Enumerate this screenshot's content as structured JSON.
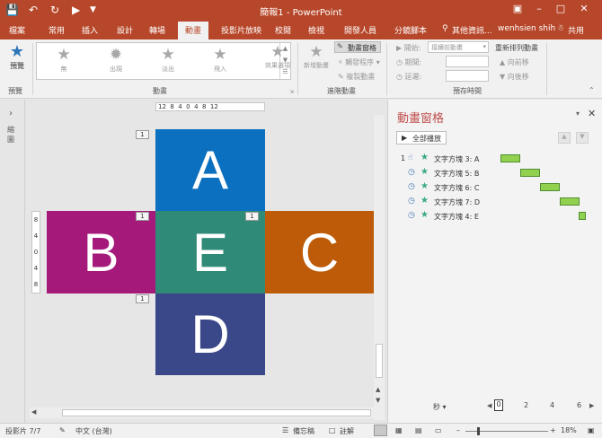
{
  "titlebar": {
    "title": "簡報1 - PowerPoint",
    "save_icon": "save-icon",
    "undo_icon": "undo-icon",
    "redo_icon": "redo-icon"
  },
  "tabs": [
    "檔案",
    "常用",
    "插入",
    "設計",
    "轉場",
    "動畫",
    "投影片放映",
    "校閱",
    "檢視",
    "開發人員",
    "分鏡腳本"
  ],
  "active_tab": "動畫",
  "tellme": "其他資訊...",
  "user": "wenhsien shih",
  "share": "共用",
  "ribbon": {
    "preview": {
      "label": "預覽",
      "group": "預覽"
    },
    "animation_gallery": [
      "無",
      "出現",
      "淡出",
      "飛入"
    ],
    "effect_options": "效果選項",
    "animation_group": "動畫",
    "add_animation": "新增動畫",
    "animation_pane_btn": "動畫窗格",
    "trigger": "觸發程序",
    "copy_animation": "複製動畫",
    "advanced_group": "進階動畫",
    "start_label": "開始:",
    "start_value": "接續前動畫",
    "duration_label": "期間:",
    "delay_label": "延遲:",
    "timing_group": "預存時間",
    "reorder_label": "重新排列動畫",
    "move_earlier": "向前移",
    "move_later": "向後移"
  },
  "left_strip": {
    "label": "縮圖"
  },
  "ruler_h": "12  8  4  0  4  8  12",
  "ruler_v": [
    "8",
    "4",
    "0",
    "4",
    "8"
  ],
  "slide": {
    "tiles": [
      {
        "letter": "A",
        "color": "#0b70bf"
      },
      {
        "letter": "B",
        "color": "#a4197a"
      },
      {
        "letter": "E",
        "color": "#308a78"
      },
      {
        "letter": "C",
        "color": "#bd5b08"
      },
      {
        "letter": "D",
        "color": "#3a4788"
      }
    ],
    "tags": [
      "1",
      "1",
      "1",
      "1"
    ]
  },
  "panel": {
    "title": "動畫窗格",
    "play_all": "全部播放",
    "items": [
      {
        "num": "1",
        "name": "文字方塊 3: A"
      },
      {
        "num": "",
        "name": "文字方塊 5: B"
      },
      {
        "num": "",
        "name": "文字方塊 6: C"
      },
      {
        "num": "",
        "name": "文字方塊 7: D"
      },
      {
        "num": "",
        "name": "文字方塊 4: E"
      }
    ],
    "seconds_label": "秒",
    "timeline": [
      "0",
      "2",
      "4",
      "6"
    ]
  },
  "status": {
    "slide": "投影片 7/7",
    "language": "中文 (台灣)",
    "notes": "備忘稿",
    "comments": "註解",
    "zoom": "18%"
  }
}
